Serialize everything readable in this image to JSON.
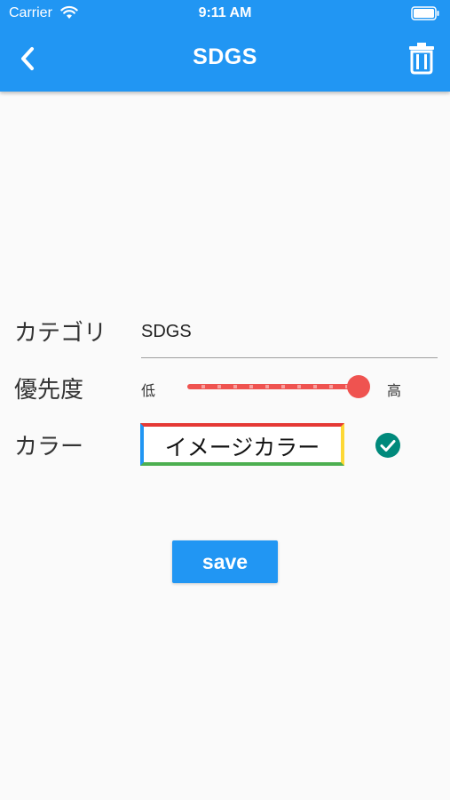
{
  "status_bar": {
    "carrier": "Carrier",
    "time": "9:11 AM",
    "wifi_icon": "wifi-icon",
    "battery_icon": "battery-icon"
  },
  "app_bar": {
    "title": "SDGS",
    "back_icon": "chevron-left-icon",
    "delete_icon": "trash-icon",
    "background_color": "#2196f3"
  },
  "form": {
    "category": {
      "label": "カテゴリ",
      "value": "SDGS"
    },
    "priority": {
      "label": "優先度",
      "min_label": "低",
      "max_label": "高",
      "value_fraction": 1.0,
      "accent_color": "#ef5350"
    },
    "color": {
      "label": "カラー",
      "button_label": "イメージカラー",
      "border_colors": [
        "#e53935",
        "#2196f3",
        "#4caf50",
        "#fdd835"
      ],
      "check_icon": "check-circle-icon",
      "check_color": "#00897b"
    }
  },
  "save_button": {
    "label": "save"
  }
}
